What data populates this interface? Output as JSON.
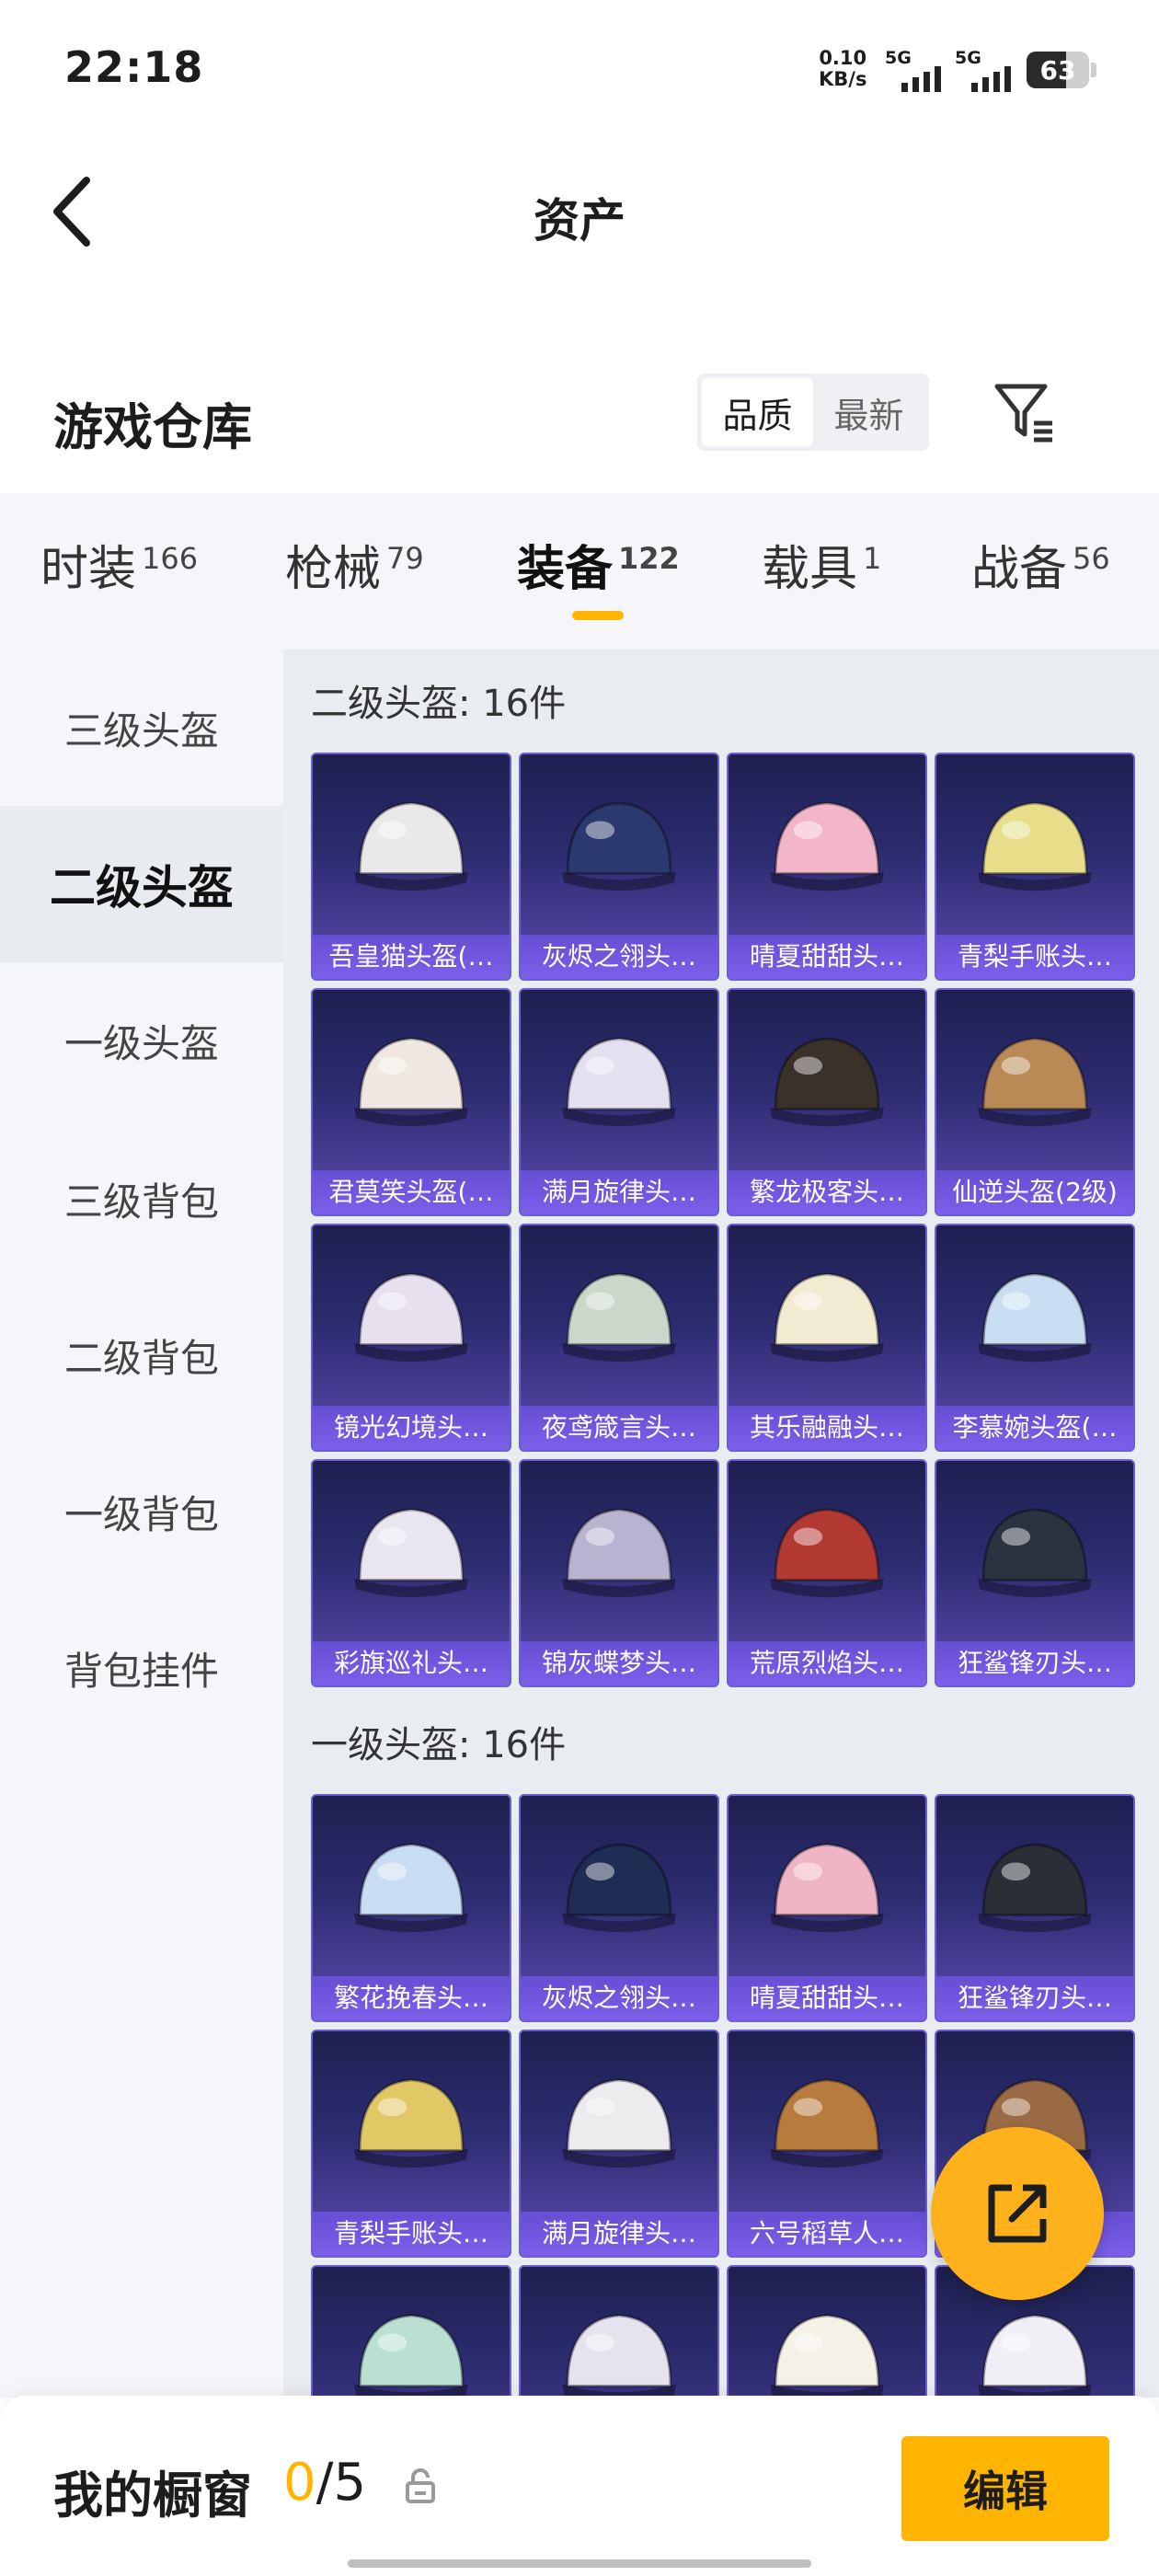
{
  "status_bar": {
    "time": "22:18",
    "net_speed": "0.10",
    "net_unit": "KB/s",
    "sim1": "5G",
    "sim2": "5G",
    "battery": "63"
  },
  "header": {
    "title": "资产"
  },
  "warehouse": {
    "title": "游戏仓库",
    "sort_options": [
      "品质",
      "最新"
    ],
    "active_sort": "品质"
  },
  "tabs": [
    {
      "label": "时装",
      "count": "166"
    },
    {
      "label": "枪械",
      "count": "79"
    },
    {
      "label": "装备",
      "count": "122"
    },
    {
      "label": "载具",
      "count": "1"
    },
    {
      "label": "战备",
      "count": "56"
    }
  ],
  "active_tab": "装备",
  "sidebar": {
    "items": [
      "三级头盔",
      "二级头盔",
      "一级头盔",
      "三级背包",
      "二级背包",
      "一级背包",
      "背包挂件"
    ],
    "active": "二级头盔"
  },
  "sections": [
    {
      "title": "二级头盔: 16件",
      "items": [
        "吾皇猫头盔(…",
        "灰烬之翎头…",
        "晴夏甜甜头…",
        "青梨手账头…",
        "君莫笑头盔(…",
        "满月旋律头…",
        "繁龙极客头…",
        "仙逆头盔(2级)",
        "镜光幻境头…",
        "夜鸢箴言头…",
        "其乐融融头…",
        "李慕婉头盔(…",
        "彩旗巡礼头…",
        "锦灰蝶梦头…",
        "荒原烈焰头…",
        "狂鲨锋刃头…"
      ]
    },
    {
      "title": "一级头盔: 16件",
      "items": [
        "繁花挽春头…",
        "灰烬之翎头…",
        "晴夏甜甜头…",
        "狂鲨锋刃头…",
        "青梨手账头…",
        "满月旋律头…",
        "六号稻草人…",
        ")",
        "",
        "",
        "",
        ""
      ]
    }
  ],
  "bottom_bar": {
    "title": "我的橱窗",
    "current": "0",
    "total": "/5",
    "edit_label": "编辑"
  },
  "colors": {
    "accent": "#ffb400",
    "card_bg": "#2c2c70",
    "card_label": "#7c60ec"
  },
  "item_colors": [
    [
      "#e9e9ea",
      "#2b3a6e",
      "#f2b6c8",
      "#e8de8a",
      "#efe7e0",
      "#e3e0ef",
      "#3a3129",
      "#b98a56",
      "#e6e0ef",
      "#c9d8c8",
      "#f3ead2",
      "#c8def0",
      "#e9e6f0",
      "#b8b4cf",
      "#b33a33",
      "#2c3340"
    ],
    [
      "#c8dcf2",
      "#1f2d55",
      "#f0b5c4",
      "#2b2e36",
      "#e2c765",
      "#ececef",
      "#b77b3e",
      "#9a6b44",
      "#b9e0d0",
      "#e5e4ee",
      "#f5f1e6",
      "#f1eef6"
    ]
  ]
}
